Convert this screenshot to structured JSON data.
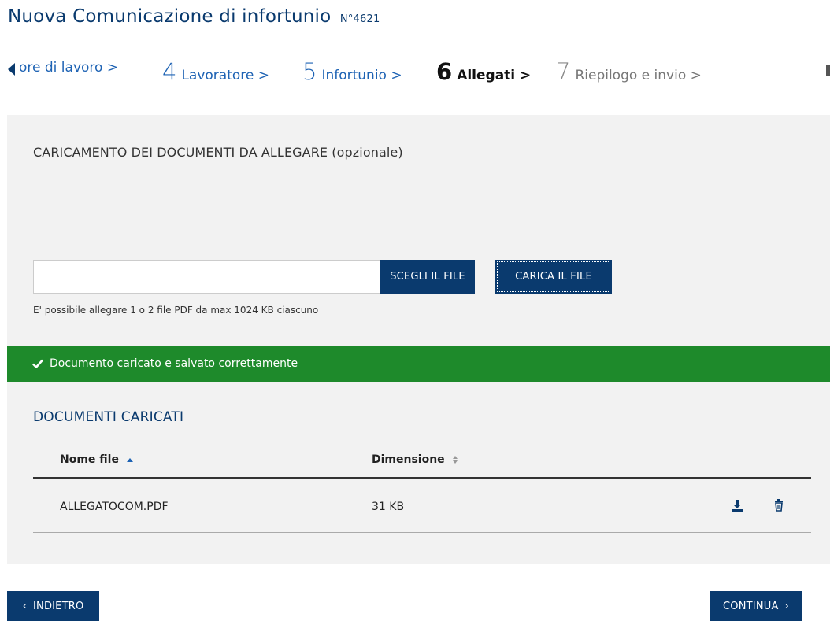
{
  "header": {
    "title": "Nuova Comunicazione di infortunio",
    "number": "N°4621"
  },
  "steps": [
    {
      "num": "",
      "label": "ore di lavoro >",
      "state": "done-cut"
    },
    {
      "num": "4",
      "label": "Lavoratore >",
      "state": "done"
    },
    {
      "num": "5",
      "label": "Infortunio >",
      "state": "done"
    },
    {
      "num": "6",
      "label": "Allegati >",
      "state": "current"
    },
    {
      "num": "7",
      "label": "Riepilogo e invio >",
      "state": "todo"
    }
  ],
  "upload": {
    "section_title": "CARICAMENTO DEI DOCUMENTI DA ALLEGARE (opzionale)",
    "file_value": "",
    "choose_label": "SCEGLI IL FILE",
    "upload_label": "CARICA IL FILE",
    "hint": "E' possibile allegare 1 o 2 file PDF da max 1024 KB ciascuno"
  },
  "alert": {
    "icon": "check-icon",
    "text": "Documento caricato e salvato correttamente",
    "color": "#1e8a2b"
  },
  "documents": {
    "title": "DOCUMENTI CARICATI",
    "columns": [
      "Nome file",
      "Dimensione"
    ],
    "rows": [
      {
        "name": "ALLEGATOCOM.PDF",
        "size": "31 KB",
        "actions": [
          "download-icon",
          "trash-icon"
        ]
      }
    ]
  },
  "nav": {
    "back_label": "INDIETRO",
    "next_label": "CONTINUA"
  },
  "colors": {
    "primary": "#0a3a6e",
    "link": "#1e63b4",
    "success": "#1e8a2b",
    "panel": "#f2f2f2"
  }
}
